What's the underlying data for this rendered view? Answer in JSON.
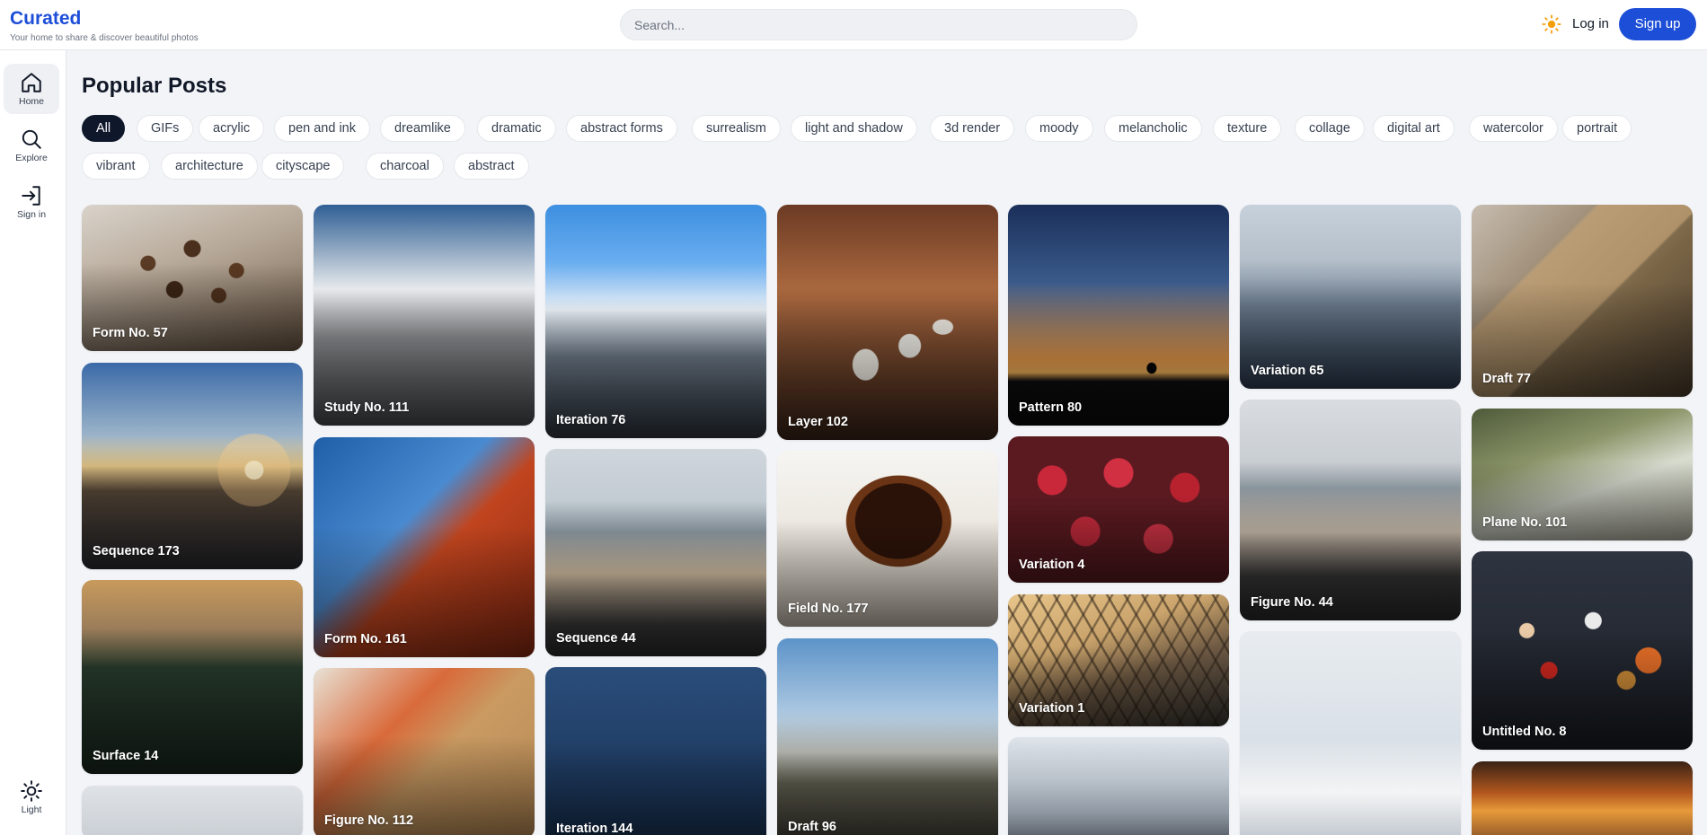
{
  "brand": {
    "title": "Curated",
    "tagline": "Your home to share & discover beautiful photos"
  },
  "search": {
    "placeholder": "Search...",
    "value": ""
  },
  "header": {
    "theme_icon": "sun-icon",
    "login_label": "Log in",
    "signup_label": "Sign up"
  },
  "sidebar": {
    "items": [
      {
        "label": "Home",
        "icon": "home-icon",
        "active": true
      },
      {
        "label": "Explore",
        "icon": "search-icon",
        "active": false
      },
      {
        "label": "Sign in",
        "icon": "sign-in-icon",
        "active": false
      }
    ],
    "theme_label": "Light",
    "theme_icon": "sun-icon"
  },
  "main": {
    "title": "Popular Posts",
    "tags": [
      "All",
      "GIFs",
      "acrylic",
      "pen and ink",
      "dreamlike",
      "dramatic",
      "abstract forms",
      "surrealism",
      "light and shadow",
      "3d render",
      "moody",
      "melancholic",
      "texture",
      "collage",
      "digital art",
      "watercolor",
      "portrait",
      "vibrant",
      "architecture",
      "cityscape",
      "charcoal",
      "abstract"
    ],
    "active_tag": "All",
    "posts": [
      {
        "title": "Form No. 57"
      },
      {
        "title": "Sequence 173"
      },
      {
        "title": "Surface 14"
      },
      {
        "title": ""
      },
      {
        "title": "Study No. 111"
      },
      {
        "title": "Form No. 161"
      },
      {
        "title": "Figure No. 112"
      },
      {
        "title": "Iteration 76"
      },
      {
        "title": "Sequence 44"
      },
      {
        "title": "Iteration 144"
      },
      {
        "title": "Layer 102"
      },
      {
        "title": "Field No. 177"
      },
      {
        "title": "Draft 96"
      },
      {
        "title": "Pattern 80"
      },
      {
        "title": "Variation 4"
      },
      {
        "title": "Variation 1"
      },
      {
        "title": ""
      },
      {
        "title": "Variation 65"
      },
      {
        "title": "Figure No. 44"
      },
      {
        "title": ""
      },
      {
        "title": "Draft 77"
      },
      {
        "title": "Plane No. 101"
      },
      {
        "title": "Untitled No. 8"
      },
      {
        "title": ""
      }
    ]
  },
  "colors": {
    "accent": "#1d4ed8",
    "active_chip": "#0f172a",
    "background": "#f2f4f8"
  }
}
